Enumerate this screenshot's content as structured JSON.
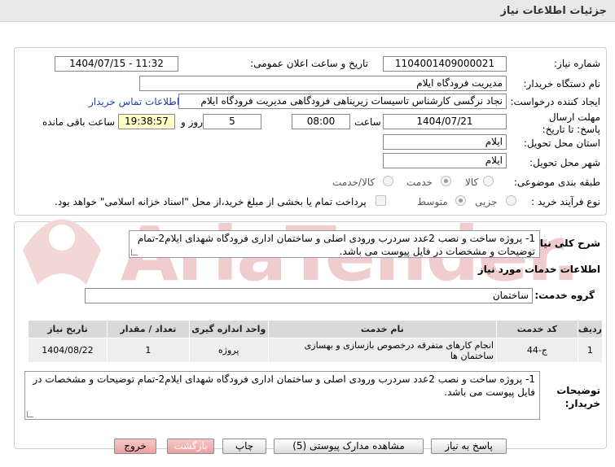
{
  "page_title": "جزئیات اطلاعات نیاز",
  "fields": {
    "need_number_label": "شماره نیاز:",
    "need_number": "1104001409000021",
    "announce_label": "تاریخ و ساعت اعلان عمومی:",
    "announce_value": "1404/07/15 - 11:32",
    "buyer_org_label": "نام دستگاه خریدار:",
    "buyer_org": "مدیریت فرودگاه ایلام",
    "creator_label": "ایجاد کننده درخواست:",
    "creator": "نجاد نرگسی کارشناس تاسیسات زیربناهی فرودگاهی مدیریت فرودگاه ایلام",
    "contact_link": "اطلاعات تماس خریدار",
    "deadline_label": "مهلت ارسال پاسخ: تا تاریخ:",
    "deadline_date": "1404/07/21",
    "hour_label": "ساعت",
    "deadline_time": "08:00",
    "days_value": "5",
    "days_label": "روز و",
    "remaining_time": "19:38:57",
    "remaining_label": "ساعت باقی مانده",
    "province_label": "استان محل تحویل:",
    "province": "ایلام",
    "city_label": "شهر محل تحویل:",
    "city": "ایلام",
    "category_label": "طبقه بندی موضوعی:",
    "category_options": [
      "کالا",
      "خدمت",
      "کالا/خدمت"
    ],
    "process_label": "نوع فرآیند خرید :",
    "process_options": [
      "جزیی",
      "متوسط"
    ],
    "treasury_note": "پرداخت تمام یا بخشی از مبلغ خرید،از محل \"اسناد خزانه اسلامی\" خواهد بود."
  },
  "general_desc": {
    "label": "شرح کلی نیاز:",
    "text": "1- پروژه ساخت و نصب 2عدد سردرب ورودی اصلی و ساختمان اداری فرودگاه شهدای ایلام2-تمام توضیحات و مشخصات در فایل پیوست می باشد."
  },
  "services": {
    "section_title": "اطلاعات خدمات مورد نیاز",
    "group_label": "گروه خدمت:",
    "group_value": "ساختمان",
    "table": {
      "headers": [
        "ردیف",
        "کد خدمت",
        "نام خدمت",
        "واحد اندازه گیری",
        "تعداد / مقدار",
        "تاریخ نیاز"
      ],
      "rows": [
        [
          "1",
          "ج-44",
          "انجام کارهای متفرقه درخصوص بازسازی و بهسازی ساختمان ها",
          "پروژه",
          "1",
          "1404/08/22"
        ]
      ]
    }
  },
  "buyer_notes": {
    "label": "توضیحات خریدار:",
    "text": "1- پروژه ساخت و نصب 2عدد سردرب ورودی اصلی و ساختمان اداری فرودگاه شهدای ایلام2-تمام توضیحات و مشخصات در فایل پیوست می باشد."
  },
  "buttons": {
    "reply": "پاسخ به نیاز",
    "attachments": "مشاهده مدارک پیوستی (5)",
    "print": "چاپ",
    "back": "بازگشت",
    "exit": "خروج"
  },
  "watermark_text": "AriaTender.net",
  "colors": {
    "link": "#1a3fb0",
    "yellow_box": "#ffffc8",
    "watermark": "#e6b3b3"
  }
}
